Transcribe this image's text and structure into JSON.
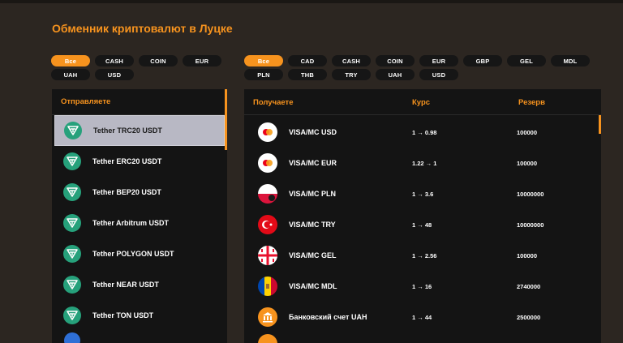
{
  "page": {
    "title": "Обменник криптовалют в Луцке"
  },
  "colors": {
    "accent": "#f7931e",
    "panel": "#141414",
    "background": "#2c2621",
    "tether": "#26a17b"
  },
  "send_filters": [
    "Все",
    "CASH",
    "COIN",
    "EUR",
    "UAH",
    "USD"
  ],
  "receive_filters": [
    "Все",
    "CAD",
    "CASH",
    "COIN",
    "EUR",
    "GBP",
    "GEL",
    "MDL",
    "PLN",
    "THB",
    "TRY",
    "UAH",
    "USD"
  ],
  "send_panel": {
    "header": "Отправляете",
    "items": [
      {
        "label": "Tether TRC20 USDT",
        "icon": "tether-icon"
      },
      {
        "label": "Tether ERC20 USDT",
        "icon": "tether-icon"
      },
      {
        "label": "Tether BEP20 USDT",
        "icon": "tether-icon"
      },
      {
        "label": "Tether Arbitrum USDT",
        "icon": "tether-icon"
      },
      {
        "label": "Tether POLYGON USDT",
        "icon": "tether-icon"
      },
      {
        "label": "Tether NEAR USDT",
        "icon": "tether-icon"
      },
      {
        "label": "Tether TON USDT",
        "icon": "tether-icon"
      }
    ]
  },
  "receive_panel": {
    "header_receive": "Получаете",
    "header_rate": "Курс",
    "header_reserve": "Резерв",
    "rows": [
      {
        "name": "VISA/MC USD",
        "rate": "1 → 0.98",
        "reserve": "100000",
        "icon": "mastercard-icon"
      },
      {
        "name": "VISA/MC EUR",
        "rate": "1.22 → 1",
        "reserve": "100000",
        "icon": "mastercard-icon"
      },
      {
        "name": "VISA/MC PLN",
        "rate": "1 → 3.6",
        "reserve": "10000000",
        "icon": "poland-flag-icon"
      },
      {
        "name": "VISA/MC TRY",
        "rate": "1 → 48",
        "reserve": "10000000",
        "icon": "turkey-flag-icon"
      },
      {
        "name": "VISA/MC GEL",
        "rate": "1 → 2.56",
        "reserve": "100000",
        "icon": "georgia-flag-icon"
      },
      {
        "name": "VISA/MC MDL",
        "rate": "1 → 16",
        "reserve": "2740000",
        "icon": "moldova-flag-icon"
      },
      {
        "name": "Банковский счет UAH",
        "rate": "1 → 44",
        "reserve": "2500000",
        "icon": "bank-icon"
      }
    ]
  }
}
